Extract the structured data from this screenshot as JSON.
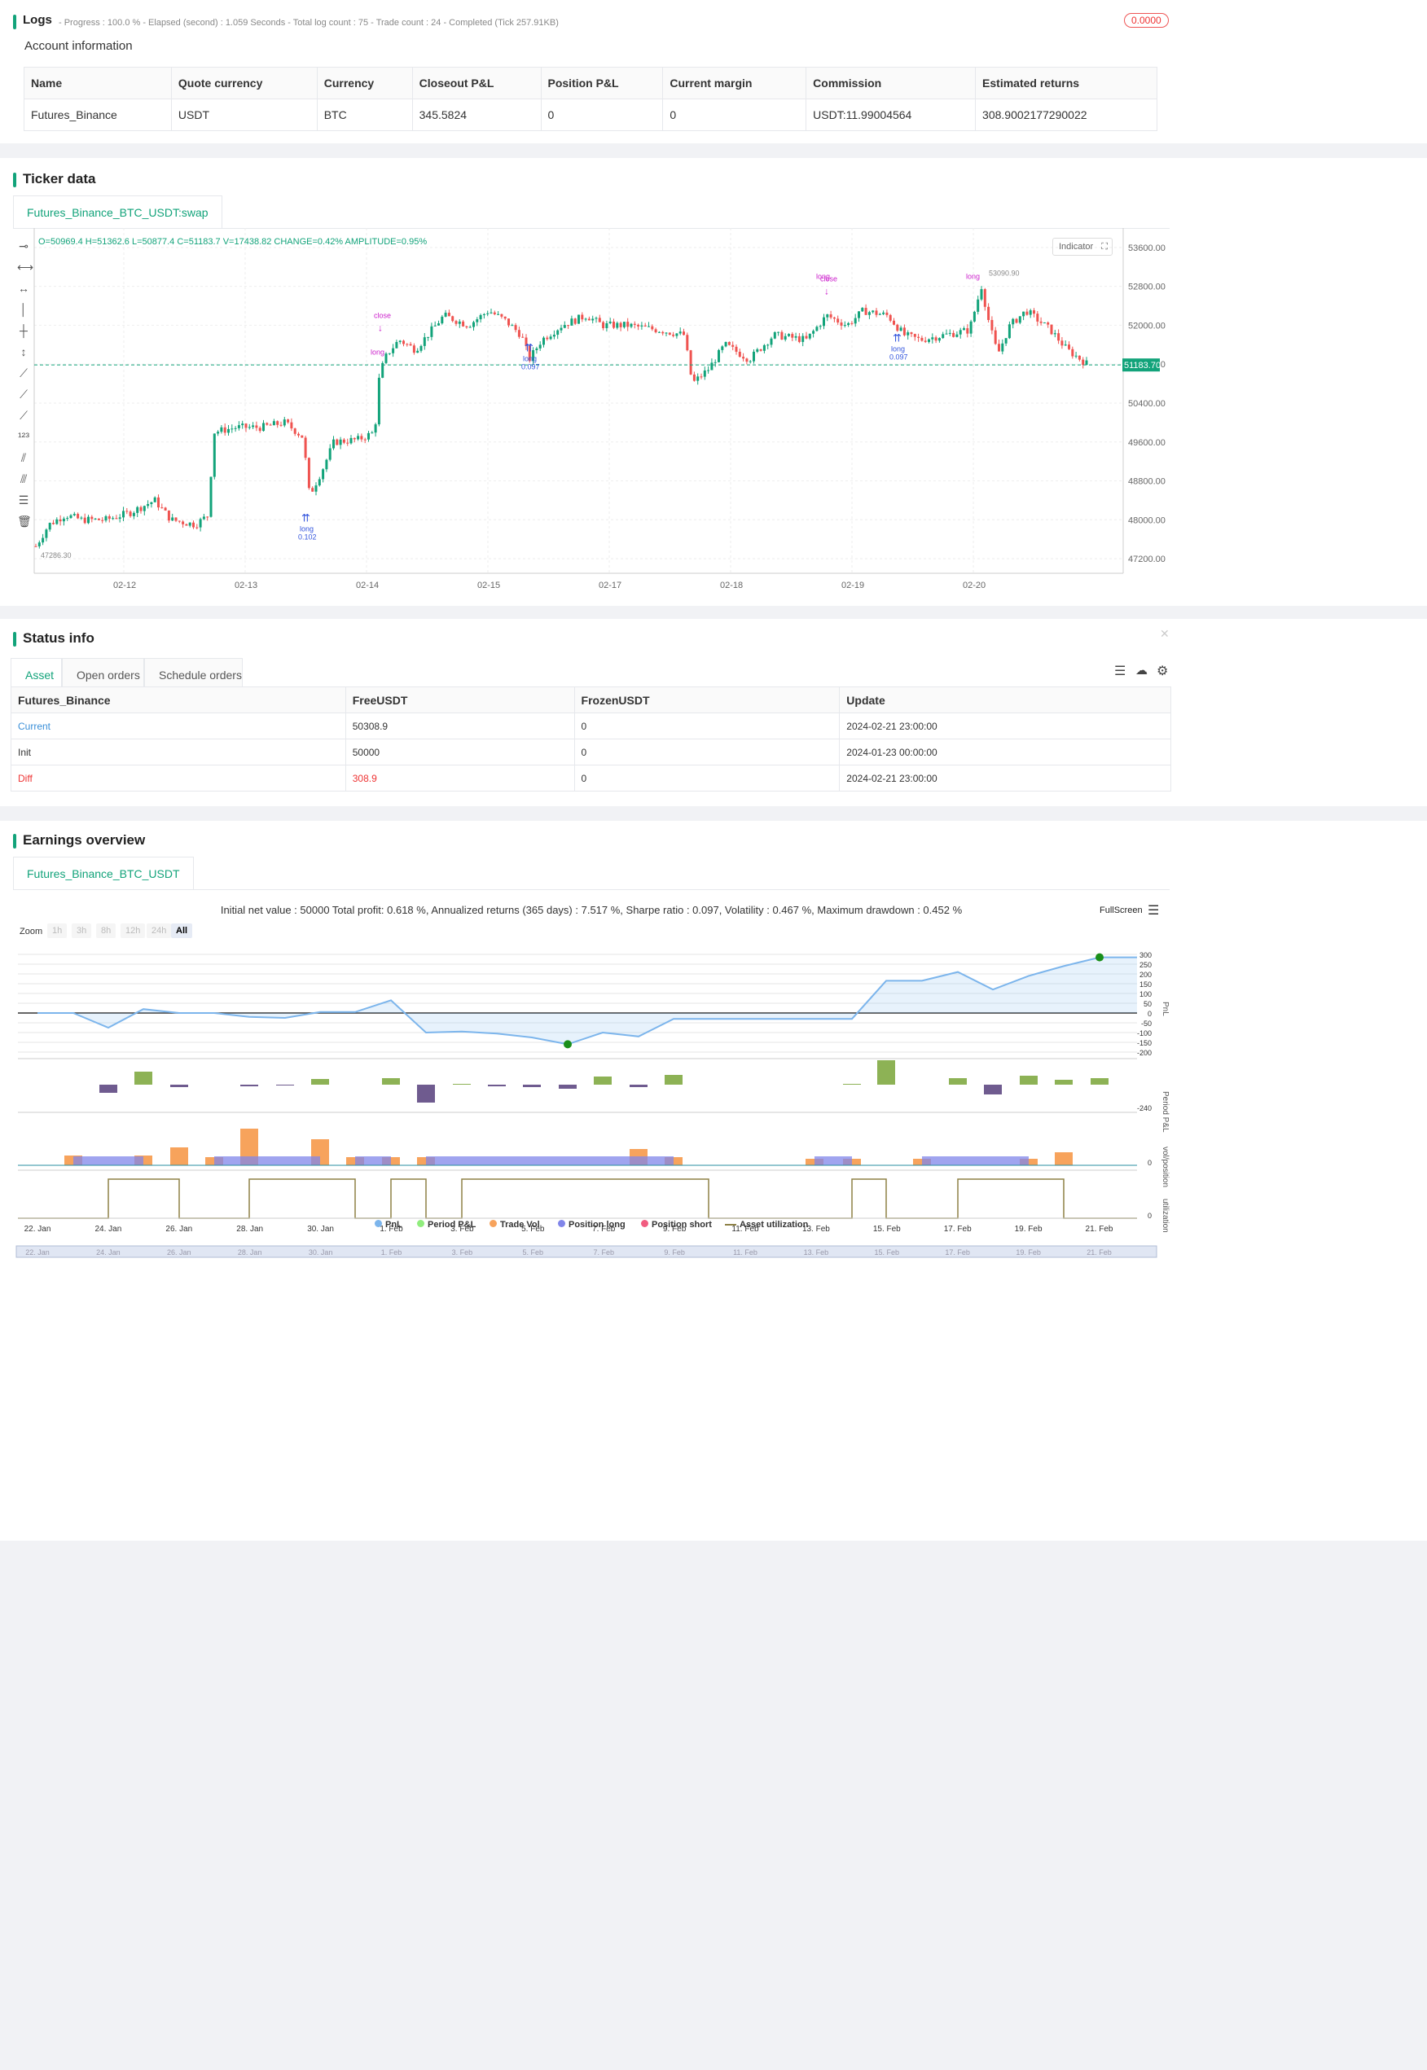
{
  "logs": {
    "title": "Logs",
    "summary": "- Progress : 100.0 % - Elapsed (second) : 1.059  Seconds - Total log count : 75 - Trade count : 24 - Completed (Tick 257.91KB)",
    "badge": "0.0000"
  },
  "account": {
    "title": "Account information",
    "headers": [
      "Name",
      "Quote currency",
      "Currency",
      "Closeout P&L",
      "Position P&L",
      "Current margin",
      "Commission",
      "Estimated returns"
    ],
    "row": [
      "Futures_Binance",
      "USDT",
      "BTC",
      "345.5824",
      "0",
      "0",
      "USDT:11.99004564",
      "308.9002177290022"
    ]
  },
  "ticker": {
    "title": "Ticker data",
    "tab": "Futures_Binance_BTC_USDT:swap",
    "ohlc": "O=50969.4 H=51362.6 L=50877.4 C=51183.7 V=17438.82 CHANGE=0.42% AMPLITUDE=0.95%",
    "indicator_btn": "Indicator",
    "price_label": "51183.70",
    "high_label": "53090.90",
    "low_label": "47286.30",
    "yticks": [
      "53600.00",
      "52800.00",
      "52000.00",
      "51200.00",
      "50400.00",
      "49600.00",
      "48800.00",
      "48000.00",
      "47200.00"
    ],
    "xticks": [
      "02-12",
      "02-13",
      "02-14",
      "02-15",
      "02-17",
      "02-18",
      "02-19",
      "02-20"
    ],
    "annotations": [
      {
        "t": "long",
        "s": "0.102"
      },
      {
        "t": "long",
        "s": "0.097"
      },
      {
        "t": "long",
        "s": "0.097"
      }
    ],
    "close_labels": [
      "close",
      "close"
    ],
    "long_labels": [
      "long",
      "long",
      "long"
    ]
  },
  "status": {
    "title": "Status info",
    "tabs": [
      "Asset",
      "Open orders",
      "Schedule orders"
    ],
    "headers": [
      "Futures_Binance",
      "FreeUSDT",
      "FrozenUSDT",
      "Update"
    ],
    "rows": [
      [
        "Current",
        "50308.9",
        "0",
        "2024-02-21 23:00:00"
      ],
      [
        "Init",
        "50000",
        "0",
        "2024-01-23 00:00:00"
      ],
      [
        "Diff",
        "308.9",
        "0",
        "2024-02-21 23:00:00"
      ]
    ]
  },
  "earnings": {
    "title": "Earnings overview",
    "tab": "Futures_Binance_BTC_USDT",
    "summary": "Initial net value : 50000 Total profit: 0.618 %, Annualized returns (365 days) : 7.517 %, Sharpe ratio : 0.097, Volatility : 0.467 %, Maximum drawdown : 0.452 %",
    "fullscreen": "FullScreen",
    "zoom_label": "Zoom",
    "zoom_opts": [
      "1h",
      "3h",
      "8h",
      "12h",
      "24h",
      "All"
    ],
    "pnl_ticks": [
      "300",
      "250",
      "200",
      "150",
      "100",
      "50",
      "0",
      "-50",
      "-100",
      "-150",
      "-200"
    ],
    "period_tick": "-240",
    "vol_tick": "0",
    "util_tick": "0",
    "axis_labels": [
      "PnL",
      "Period P&L",
      "vol/position",
      "utilization"
    ],
    "xticks": [
      "22. Jan",
      "24. Jan",
      "26. Jan",
      "28. Jan",
      "30. Jan",
      "1. Feb",
      "3. Feb",
      "5. Feb",
      "7. Feb",
      "9. Feb",
      "11. Feb",
      "13. Feb",
      "15. Feb",
      "17. Feb",
      "19. Feb",
      "21. Feb"
    ],
    "legend": [
      {
        "name": "PnL",
        "color": "#7cb5ec"
      },
      {
        "name": "Period P&L",
        "color": "#90ed7d"
      },
      {
        "name": "Trade Vol",
        "color": "#f7a35c"
      },
      {
        "name": "Position long",
        "color": "#8085e9"
      },
      {
        "name": "Position short",
        "color": "#f15c80"
      },
      {
        "name": "Asset utilization",
        "color": "#8d8045"
      }
    ]
  }
}
